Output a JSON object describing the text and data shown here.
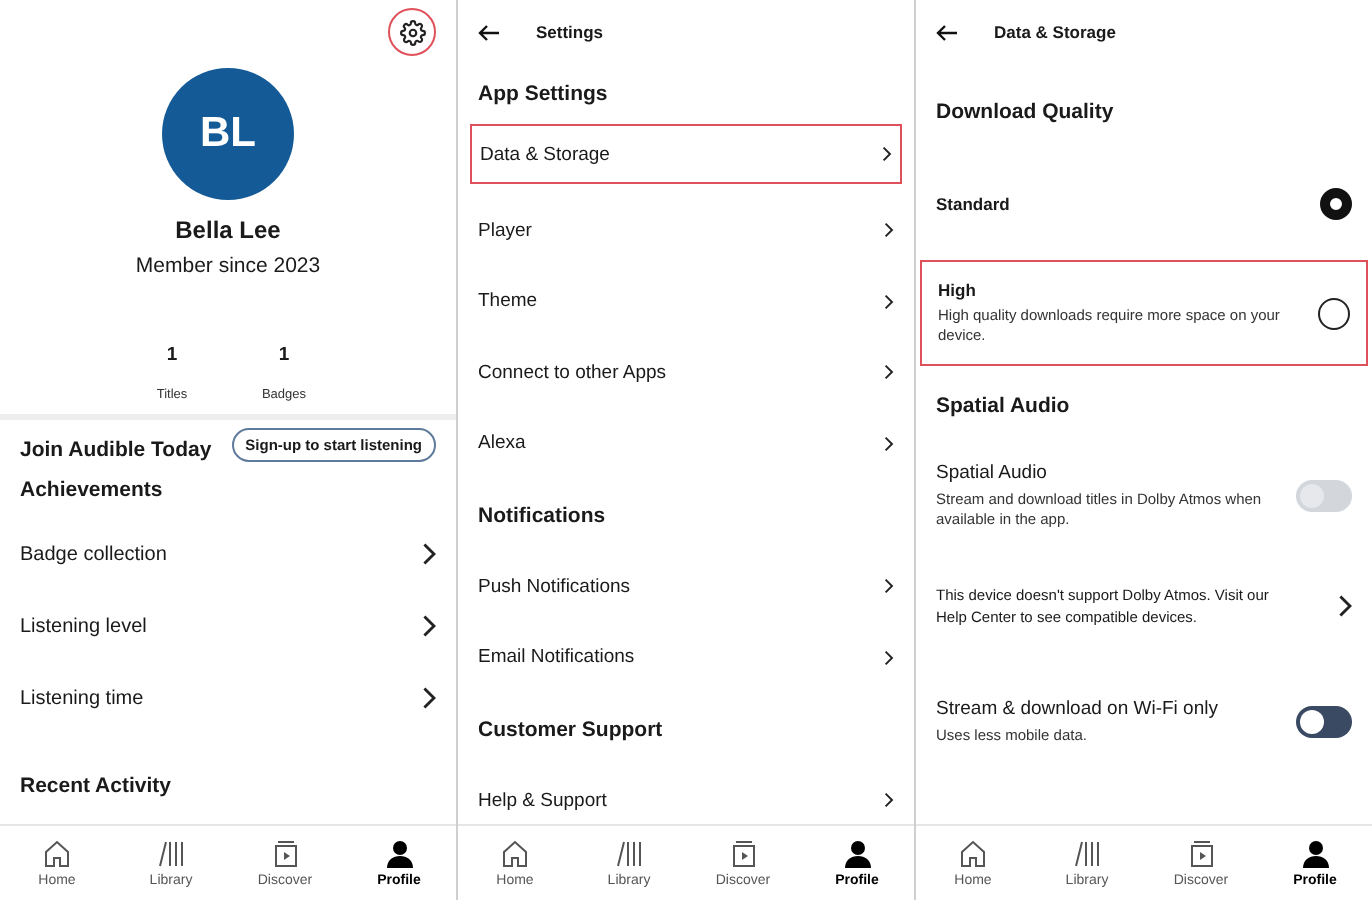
{
  "panels": [
    {
      "kind": "profile",
      "settings_highlighted": true,
      "initials": "BL",
      "name": "Bella Lee",
      "member_since": "Member since 2023",
      "stats": [
        {
          "value": "1",
          "label": "Titles"
        },
        {
          "value": "1",
          "label": "Badges"
        }
      ],
      "join_title": "Join Audible Today",
      "signup_button": "Sign-up to start listening",
      "rows": [
        {
          "kind": "heading",
          "label": "Achievements"
        },
        {
          "kind": "link",
          "label": "Badge collection",
          "highlighted": false
        },
        {
          "kind": "link",
          "label": "Listening level",
          "highlighted": false
        },
        {
          "kind": "link",
          "label": "Listening time",
          "highlighted": false
        },
        {
          "kind": "heading",
          "label": "Recent Activity"
        }
      ],
      "nav": [
        {
          "label": "Home",
          "kind": "home",
          "selected": false
        },
        {
          "label": "Library",
          "kind": "library",
          "selected": false
        },
        {
          "label": "Discover",
          "kind": "discover",
          "selected": false
        },
        {
          "label": "Profile",
          "kind": "profile",
          "selected": true
        }
      ]
    },
    {
      "kind": "list",
      "title": "Settings",
      "rows": [
        {
          "kind": "heading",
          "label": "App Settings"
        },
        {
          "kind": "link",
          "label": "Data & Storage",
          "highlighted": true
        },
        {
          "kind": "link",
          "label": "Player",
          "highlighted": false
        },
        {
          "kind": "link",
          "label": "Theme",
          "highlighted": false
        },
        {
          "kind": "link",
          "label": "Connect to other Apps",
          "highlighted": false
        },
        {
          "kind": "link",
          "label": "Alexa",
          "highlighted": false
        },
        {
          "kind": "heading",
          "label": "Notifications"
        },
        {
          "kind": "link",
          "label": "Push Notifications",
          "highlighted": false
        },
        {
          "kind": "link",
          "label": "Email Notifications",
          "highlighted": false
        },
        {
          "kind": "heading",
          "label": "Customer Support"
        },
        {
          "kind": "link",
          "label": "Help & Support",
          "highlighted": false
        }
      ],
      "nav": [
        {
          "label": "Home",
          "kind": "home",
          "selected": false
        },
        {
          "label": "Library",
          "kind": "library",
          "selected": false
        },
        {
          "label": "Discover",
          "kind": "discover",
          "selected": false
        },
        {
          "label": "Profile",
          "kind": "profile",
          "selected": true
        }
      ]
    },
    {
      "kind": "list",
      "title": "Data & Storage",
      "rows": [
        {
          "kind": "heading",
          "label": "Download Quality"
        },
        {
          "kind": "radio",
          "label": "Standard",
          "selected": true,
          "highlighted": false
        },
        {
          "kind": "radio",
          "label": "High",
          "description": "High quality downloads require more space on your device.",
          "selected": false,
          "highlighted": true
        },
        {
          "kind": "heading",
          "label": "Spatial Audio"
        },
        {
          "kind": "toggle",
          "label": "Spatial Audio",
          "description": "Stream and download titles in Dolby Atmos when available in the app.",
          "disabled": true
        },
        {
          "kind": "note",
          "label": "This device doesn't support Dolby Atmos. Visit our Help Center to see compatible devices."
        },
        {
          "kind": "toggle",
          "label": "Stream & download on Wi-Fi only",
          "description": "Uses less mobile data.",
          "disabled": false
        }
      ],
      "nav": [
        {
          "label": "Home",
          "kind": "home",
          "selected": false
        },
        {
          "label": "Library",
          "kind": "library",
          "selected": false
        },
        {
          "label": "Discover",
          "kind": "discover",
          "selected": false
        },
        {
          "label": "Profile",
          "kind": "profile",
          "selected": true
        }
      ]
    }
  ]
}
